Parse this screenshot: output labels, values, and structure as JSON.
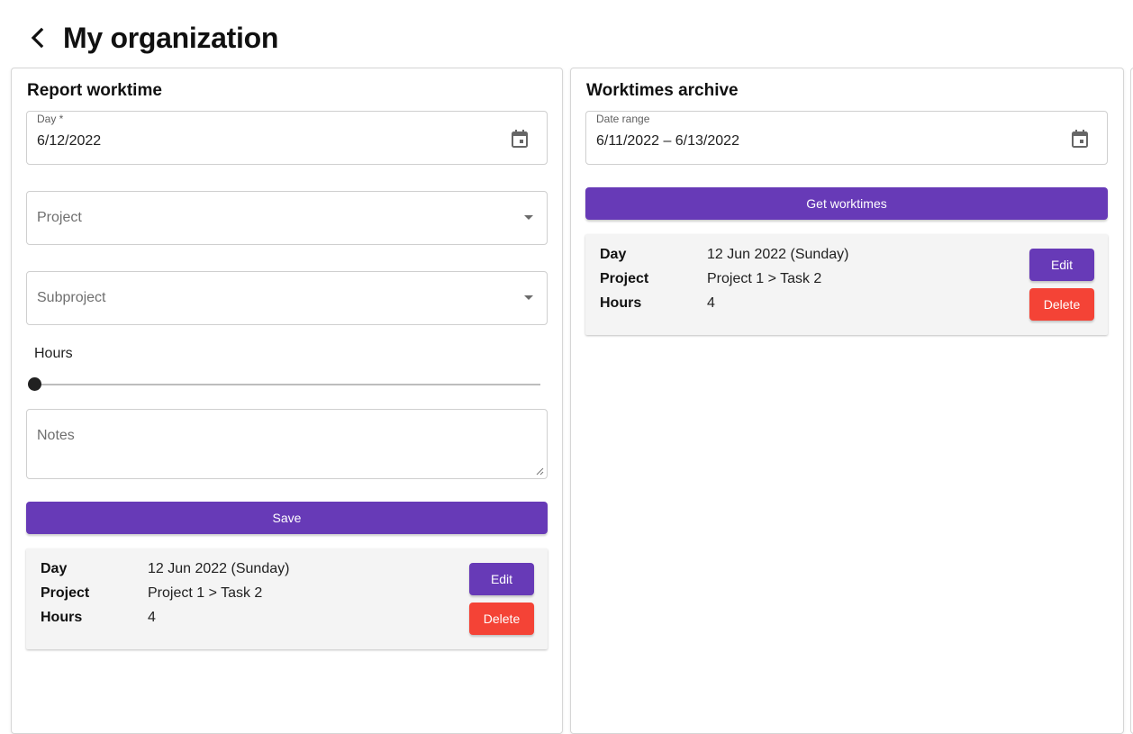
{
  "header": {
    "title": "My organization",
    "back_icon": "chevron-left-icon"
  },
  "report_panel": {
    "title": "Report worktime",
    "day_field": {
      "label": "Day *",
      "value": "6/12/2022",
      "icon": "calendar-icon"
    },
    "project_field": {
      "placeholder": "Project"
    },
    "subproject_field": {
      "placeholder": "Subproject"
    },
    "hours": {
      "label": "Hours",
      "value": 0
    },
    "notes": {
      "placeholder": "Notes"
    },
    "save_label": "Save",
    "entry": {
      "day_key": "Day",
      "day_value": "12 Jun 2022 (Sunday)",
      "project_key": "Project",
      "project_value": "Project 1 > Task 2",
      "hours_key": "Hours",
      "hours_value": "4",
      "edit_label": "Edit",
      "delete_label": "Delete"
    }
  },
  "archive_panel": {
    "title": "Worktimes archive",
    "date_range_field": {
      "label": "Date range",
      "value": "6/11/2022 – 6/13/2022",
      "icon": "calendar-icon"
    },
    "get_label": "Get worktimes",
    "entry": {
      "day_key": "Day",
      "day_value": "12 Jun 2022 (Sunday)",
      "project_key": "Project",
      "project_value": "Project 1 > Task 2",
      "hours_key": "Hours",
      "hours_value": "4",
      "edit_label": "Edit",
      "delete_label": "Delete"
    }
  },
  "colors": {
    "primary": "#673ab7",
    "danger": "#f44336",
    "card_bg": "#f4f4f4"
  }
}
